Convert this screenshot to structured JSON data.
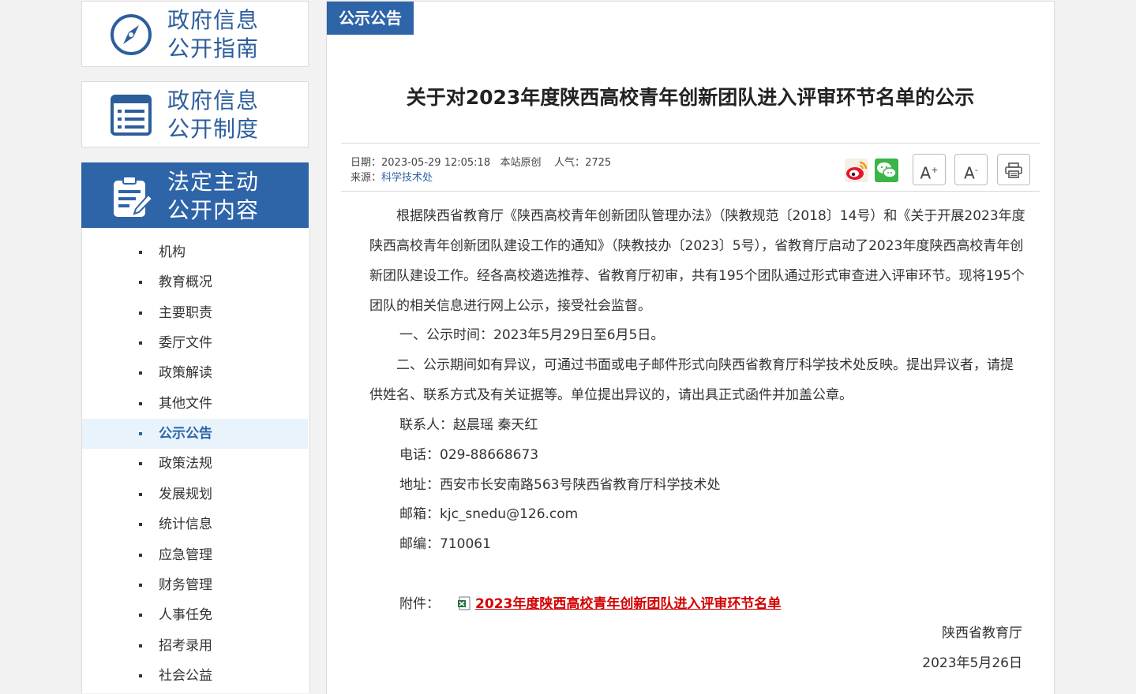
{
  "sidebar": {
    "guide": {
      "line1": "政府信息",
      "line2": "公开指南",
      "icon": "compass-icon"
    },
    "system": {
      "line1": "政府信息",
      "line2": "公开制度",
      "icon": "list-icon"
    },
    "active": {
      "line1": "法定主动",
      "line2": "公开内容",
      "icon": "clipboard-edit-icon"
    },
    "items": [
      {
        "label": "机构"
      },
      {
        "label": "教育概况"
      },
      {
        "label": "主要职责"
      },
      {
        "label": "委厅文件"
      },
      {
        "label": "政策解读"
      },
      {
        "label": "其他文件"
      },
      {
        "label": "公示公告"
      },
      {
        "label": "政策法规"
      },
      {
        "label": "发展规划"
      },
      {
        "label": "统计信息"
      },
      {
        "label": "应急管理"
      },
      {
        "label": "财务管理"
      },
      {
        "label": "人事任免"
      },
      {
        "label": "招考录用"
      },
      {
        "label": "社会公益"
      }
    ],
    "active_item": "公示公告"
  },
  "main": {
    "tab": "公示公告",
    "title": "关于对2023年度陕西高校青年创新团队进入评审环节名单的公示",
    "meta": {
      "date_label": "日期：",
      "date": "2023-05-29 12:05:18",
      "origin": "本站原创",
      "views_label": "人气：",
      "views": "2725",
      "source_label": "来源：",
      "source": "科学技术处"
    },
    "tools": {
      "weibo": "weibo-icon",
      "wechat": "wechat-icon",
      "font_up": "A",
      "font_down": "A",
      "print": "print-icon"
    },
    "body": {
      "p1": "根据陕西省教育厅《陕西高校青年创新团队管理办法》（陕教规范〔2018〕14号）和《关于开展2023年度陕西高校青年创新团队建设工作的通知》（陕教技办〔2023〕5号），省教育厅启动了2023年度陕西高校青年创新团队建设工作。经各高校遴选推荐、省教育厅初审，共有195个团队通过形式审查进入评审环节。现将195个团队的相关信息进行网上公示，接受社会监督。",
      "p2": "一、公示时间：2023年5月29日至6月5日。",
      "p3": "二、公示期间如有异议，可通过书面或电子邮件形式向陕西省教育厅科学技术处反映。提出异议者，请提供姓名、联系方式及有关证据等。单位提出异议的，请出具正式函件并加盖公章。",
      "contact": "联系人：赵晨瑶 秦天红",
      "phone": "电话：029-88668673",
      "address": "地址：西安市长安南路563号陕西省教育厅科学技术处",
      "email": "邮箱：kjc_snedu@126.com",
      "zip": "邮编：710061",
      "attach_label": "附件：",
      "attach_name": "2023年度陕西高校青年创新团队进入评审环节名单",
      "signature": "陕西省教育厅",
      "sign_date": "2023年5月26日"
    }
  }
}
